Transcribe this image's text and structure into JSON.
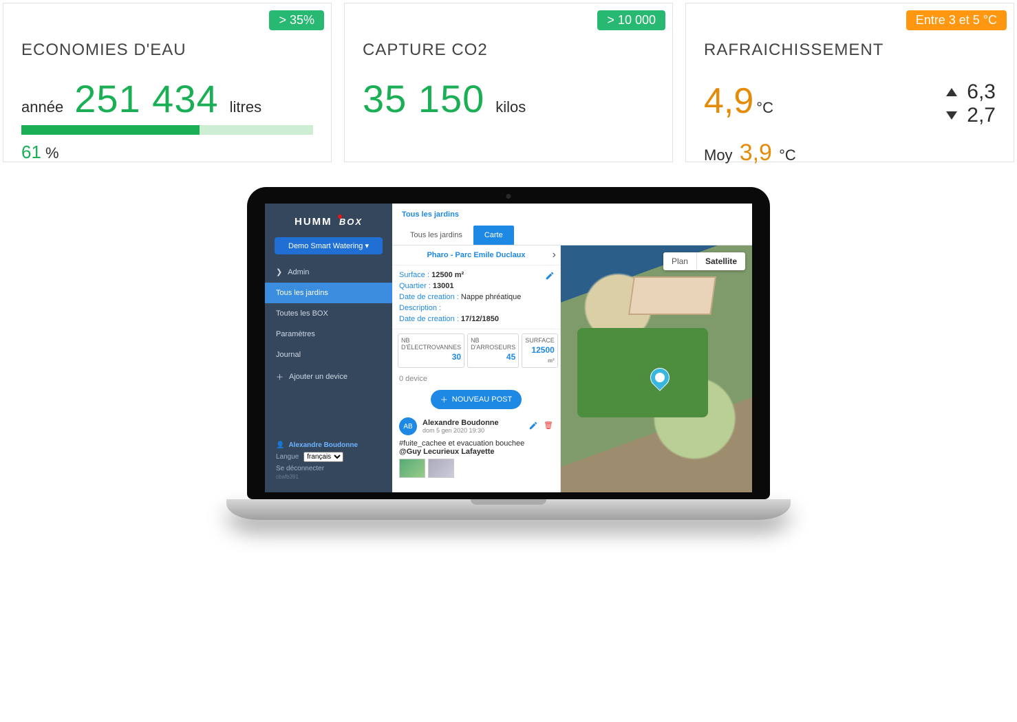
{
  "cards": {
    "water": {
      "badge": "> 35%",
      "title": "ECONOMIES D'EAU",
      "prefix": "année",
      "value": "251 434",
      "unit": "litres",
      "bar_pct": 61,
      "pct_value": "61",
      "pct_unit": "%"
    },
    "co2": {
      "badge": "> 10 000",
      "title": "CAPTURE CO2",
      "value": "35 150",
      "unit": "kilos"
    },
    "cooling": {
      "badge": "Entre 3 et 5 °C",
      "title": "RAFRAICHISSEMENT",
      "value": "4,9",
      "unit": "°C",
      "high": "6,3",
      "low": "2,7",
      "avg_label": "Moy",
      "avg_value": "3,9",
      "avg_unit": "°C"
    }
  },
  "app": {
    "logo_a": "HUMM",
    "logo_b": "BOX",
    "account_dd": "Demo Smart Watering",
    "sidebar": {
      "admin": "Admin",
      "all_gardens": "Tous les jardins",
      "all_boxes": "Toutes les BOX",
      "params": "Paramètres",
      "journal": "Journal",
      "add_device": "Ajouter un device"
    },
    "footer": {
      "user": "Alexandre Boudonne",
      "lang_label": "Langue",
      "lang_value": "français",
      "logout": "Se déconnecter",
      "build": "cbafb391"
    },
    "breadcrumb": "Tous les jardins",
    "tabs": {
      "list": "Tous les jardins",
      "map": "Carte"
    },
    "detail": {
      "title": "Pharo - Parc Emile Duclaux",
      "surface_lbl": "Surface :",
      "surface_val": "12500 m²",
      "quartier_lbl": "Quartier :",
      "quartier_val": "13001",
      "creation_lbl": "Date de creation :",
      "creation_val": "Nappe phréatique",
      "desc_lbl": "Description :",
      "creation2_lbl": "Date de creation :",
      "creation2_val": "17/12/1850",
      "mini": [
        {
          "lbl": "NB D'ÉLECTROVANNES",
          "val": "30"
        },
        {
          "lbl": "NB D'ARROSEURS",
          "val": "45"
        },
        {
          "lbl": "SURFACE",
          "val": "12500",
          "unit": "m²"
        }
      ],
      "device_count": "0 device",
      "new_post": "NOUVEAU POST"
    },
    "post": {
      "initials": "AB",
      "author": "Alexandre Boudonne",
      "date": "dom 5 gen 2020 19:30",
      "body": "#fuite_cachee et evacuation bouchee",
      "mention": "@Guy Lecurieux Lafayette"
    },
    "map": {
      "plan": "Plan",
      "satellite": "Satellite"
    }
  }
}
